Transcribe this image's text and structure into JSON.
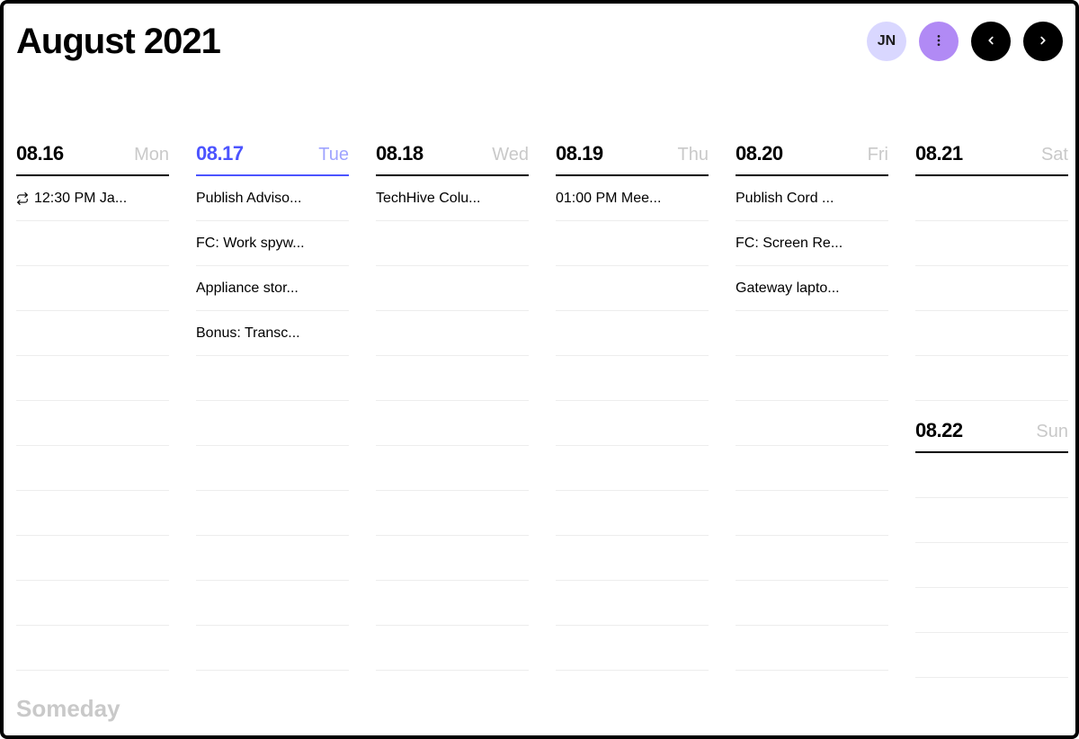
{
  "header": {
    "title": "August 2021",
    "avatar_initials": "JN"
  },
  "days": [
    {
      "date": "08.16",
      "dow": "Mon",
      "current": false,
      "tasks": [
        {
          "text": "12:30 PM Ja...",
          "recurring": true
        }
      ]
    },
    {
      "date": "08.17",
      "dow": "Tue",
      "current": true,
      "tasks": [
        {
          "text": "Publish Adviso..."
        },
        {
          "text": "FC: Work spyw..."
        },
        {
          "text": "Appliance stor..."
        },
        {
          "text": "Bonus: Transc..."
        }
      ]
    },
    {
      "date": "08.18",
      "dow": "Wed",
      "current": false,
      "tasks": [
        {
          "text": "TechHive Colu..."
        }
      ]
    },
    {
      "date": "08.19",
      "dow": "Thu",
      "current": false,
      "tasks": [
        {
          "text": "01:00 PM Mee..."
        }
      ]
    },
    {
      "date": "08.20",
      "dow": "Fri",
      "current": false,
      "tasks": [
        {
          "text": "Publish Cord ..."
        },
        {
          "text": "FC: Screen Re..."
        },
        {
          "text": "Gateway lapto..."
        }
      ]
    }
  ],
  "weekend": {
    "sat": {
      "date": "08.21",
      "dow": "Sat",
      "tasks": []
    },
    "sun": {
      "date": "08.22",
      "dow": "Sun",
      "tasks": []
    }
  },
  "someday_label": "Someday",
  "row_counts": {
    "weekday": 11,
    "sat": 5,
    "sun": 5
  }
}
